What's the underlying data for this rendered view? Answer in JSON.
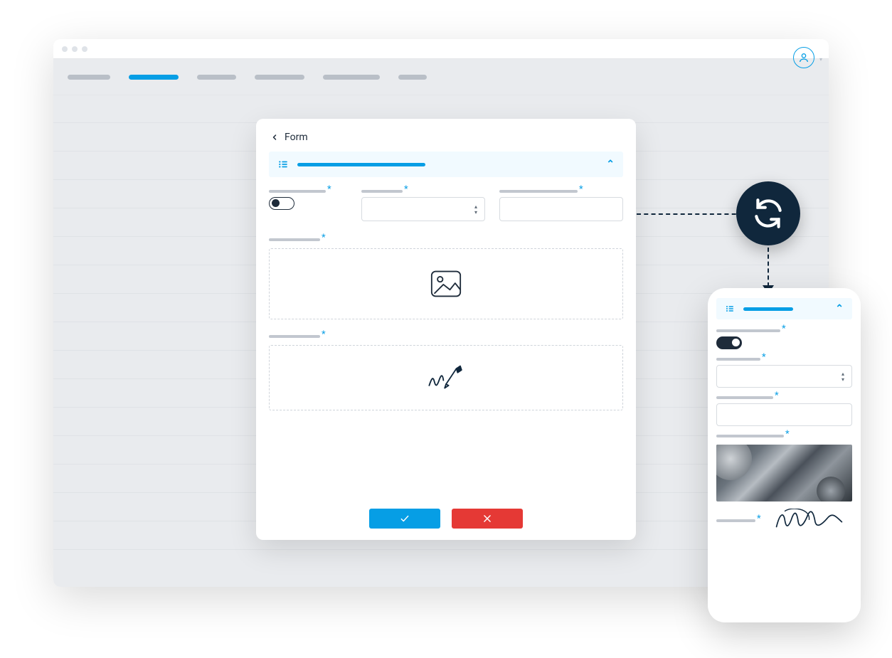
{
  "form": {
    "title": "Form",
    "confirm_icon": "check",
    "cancel_icon": "x"
  },
  "colors": {
    "accent": "#069ee5",
    "dark": "#10273c",
    "danger": "#e53935"
  }
}
